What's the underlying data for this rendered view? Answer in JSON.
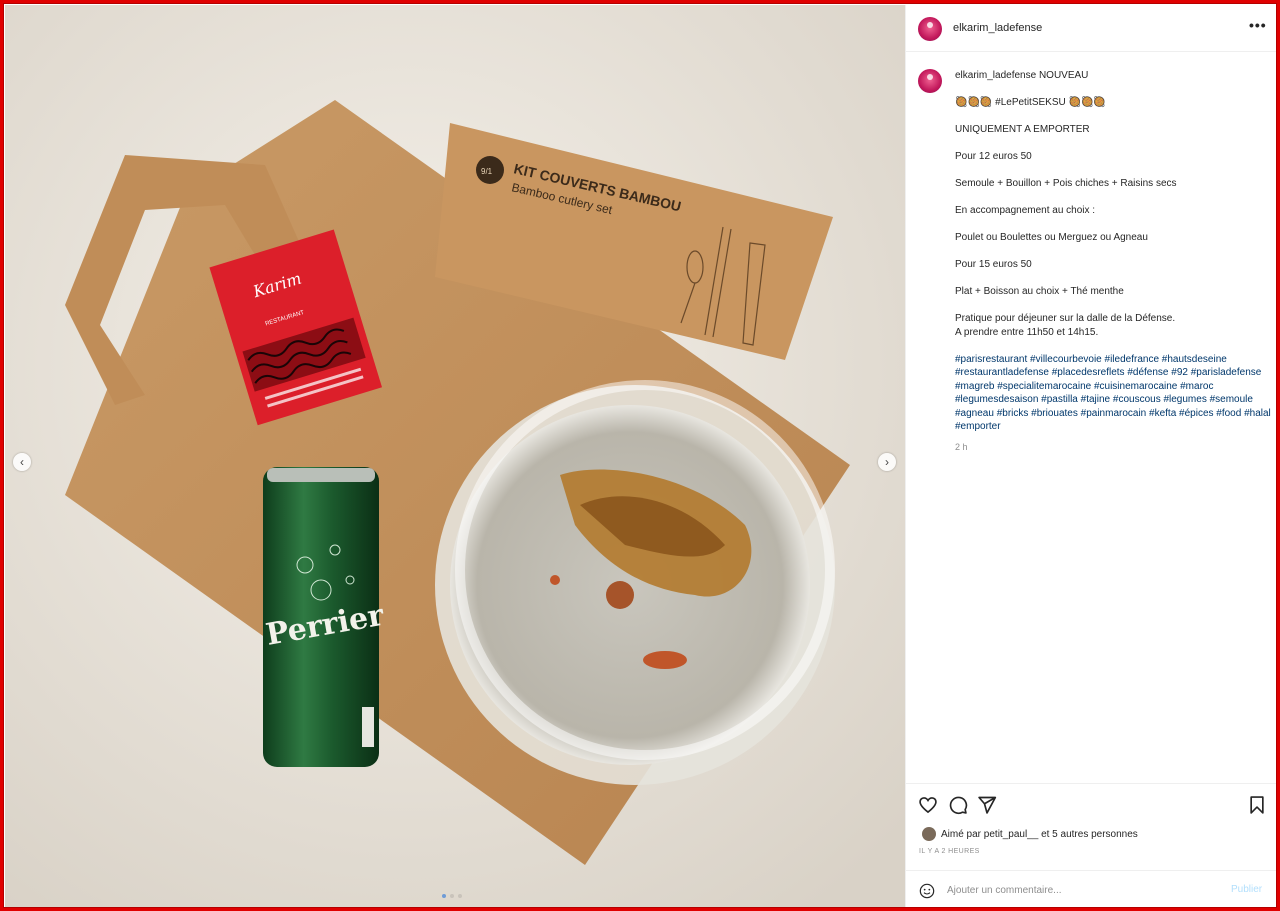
{
  "post": {
    "username": "elkarim_ladefense",
    "more_icon": "•••"
  },
  "media": {
    "nav_prev": "‹",
    "nav_next": "›",
    "cutlery_title": "KIT COUVERTS BAMBOU",
    "cutlery_subtitle": "Bamboo cutlery set",
    "cutlery_badge": "9/1",
    "can_label": "Perrier",
    "card_name": "Karim",
    "card_tag": "RESTAURANT",
    "dots": 3
  },
  "caption": {
    "username": "elkarim_ladefense",
    "first_line": "NOUVEAU",
    "tag_line": "🥘🥘🥘 #LePetitSEKSU 🥘🥘🥘",
    "lines": [
      "UNIQUEMENT A EMPORTER",
      "Pour 12 euros 50",
      "Semoule + Bouillon + Pois chiches + Raisins secs",
      "En accompagnement au choix :",
      "Poulet ou Boulettes ou Merguez ou Agneau",
      "Pour 15 euros 50",
      "Plat + Boisson au choix + Thé menthe"
    ],
    "practical_1": "Pratique pour déjeuner sur la dalle de la Défense.",
    "practical_2": "A prendre entre 11h50 et 14h15.",
    "hashtags": "#parisrestaurant #villecourbevoie #iledefrance #hautsdeseine #restaurantladefense #placedesreflets #défense #92 #parisladefense #magreb #specialitemarocaine #cuisinemarocaine #maroc #legumesdesaison #pastilla #tajine #couscous #legumes #semoule #agneau #bricks #briouates #painmarocain #kefta #épices #food #halal #emporter",
    "time": "2 h"
  },
  "likes": {
    "text": "Aimé par petit_paul__ et 5 autres personnes"
  },
  "timestamp": "IL Y A 2 HEURES",
  "comment": {
    "placeholder": "Ajouter un commentaire...",
    "publish": "Publier"
  },
  "icons": [
    "heart-icon",
    "comment-icon",
    "share-icon",
    "bookmark-icon",
    "emoji-icon"
  ],
  "colors": {
    "frame": "#e00000",
    "hashtag": "#00376b",
    "publish_disabled": "#b2dffc",
    "muted": "#8e8e8e"
  }
}
